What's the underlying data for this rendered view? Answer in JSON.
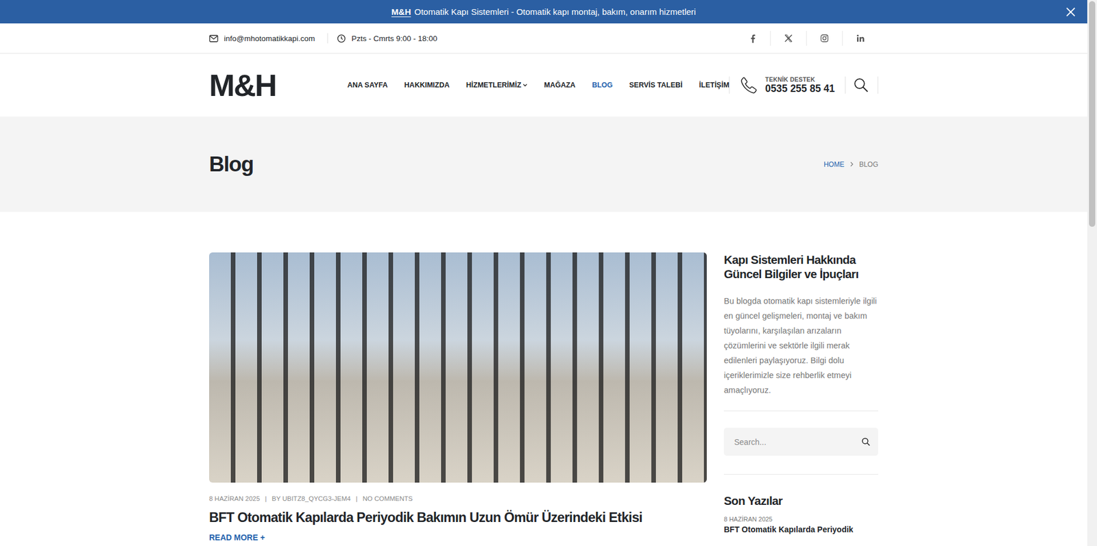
{
  "notice": {
    "brand": "M&H",
    "text": "Otomatik Kapı Sistemleri - Otomatik kapı montaj, bakım, onarım hizmetleri"
  },
  "topbar": {
    "email": "info@mhotomatikkapi.com",
    "hours": "Pzts - Cmrts 9:00 - 18:00"
  },
  "logo": "M&H",
  "nav": [
    {
      "label": "ANA SAYFA",
      "selected": false,
      "dropdown": false
    },
    {
      "label": "HAKKIMIZDA",
      "selected": false,
      "dropdown": false
    },
    {
      "label": "HİZMETLERİMİZ",
      "selected": false,
      "dropdown": true
    },
    {
      "label": "MAĞAZA",
      "selected": false,
      "dropdown": false
    },
    {
      "label": "BLOG",
      "selected": true,
      "dropdown": false
    },
    {
      "label": "SERVİS TALEBİ",
      "selected": false,
      "dropdown": false
    },
    {
      "label": "İLETİŞİM",
      "selected": false,
      "dropdown": false
    }
  ],
  "support": {
    "label": "TEKNİK DESTEK",
    "phone": "0535 255 85 41"
  },
  "page_title": "Blog",
  "breadcrumb": [
    {
      "label": "HOME",
      "selected": false
    },
    {
      "label": "BLOG",
      "selected": true
    }
  ],
  "post": {
    "date": "8 HAZİRAN 2025",
    "author": "BY UBITZ8_QYCG3-JEM4",
    "comments": "NO COMMENTS",
    "separator": "|",
    "title": "BFT Otomatik Kapılarda Periyodik Bakımın Uzun Ömür Üzerindeki Etkisi",
    "read_more": "READ MORE +"
  },
  "sidebar": {
    "about_title": "Kapı Sistemleri Hakkında Güncel Bilgiler ve İpuçları",
    "about_text": "Bu blogda otomatik kapı sistemleriyle ilgili en güncel gelişmeleri, montaj ve bakım tüyolarını, karşılaşılan arızaların çözümlerini ve sektörle ilgili merak edilenleri paylaşıyoruz. Bilgi dolu içeriklerimizle size rehberlik etmeyi amaçlıyoruz.",
    "search_placeholder": "Search...",
    "recent_title": "Son Yazılar",
    "recent": [
      {
        "date": "8 HAZİRAN 2025",
        "title": "BFT Otomatik Kapılarda Periyodik"
      }
    ]
  }
}
